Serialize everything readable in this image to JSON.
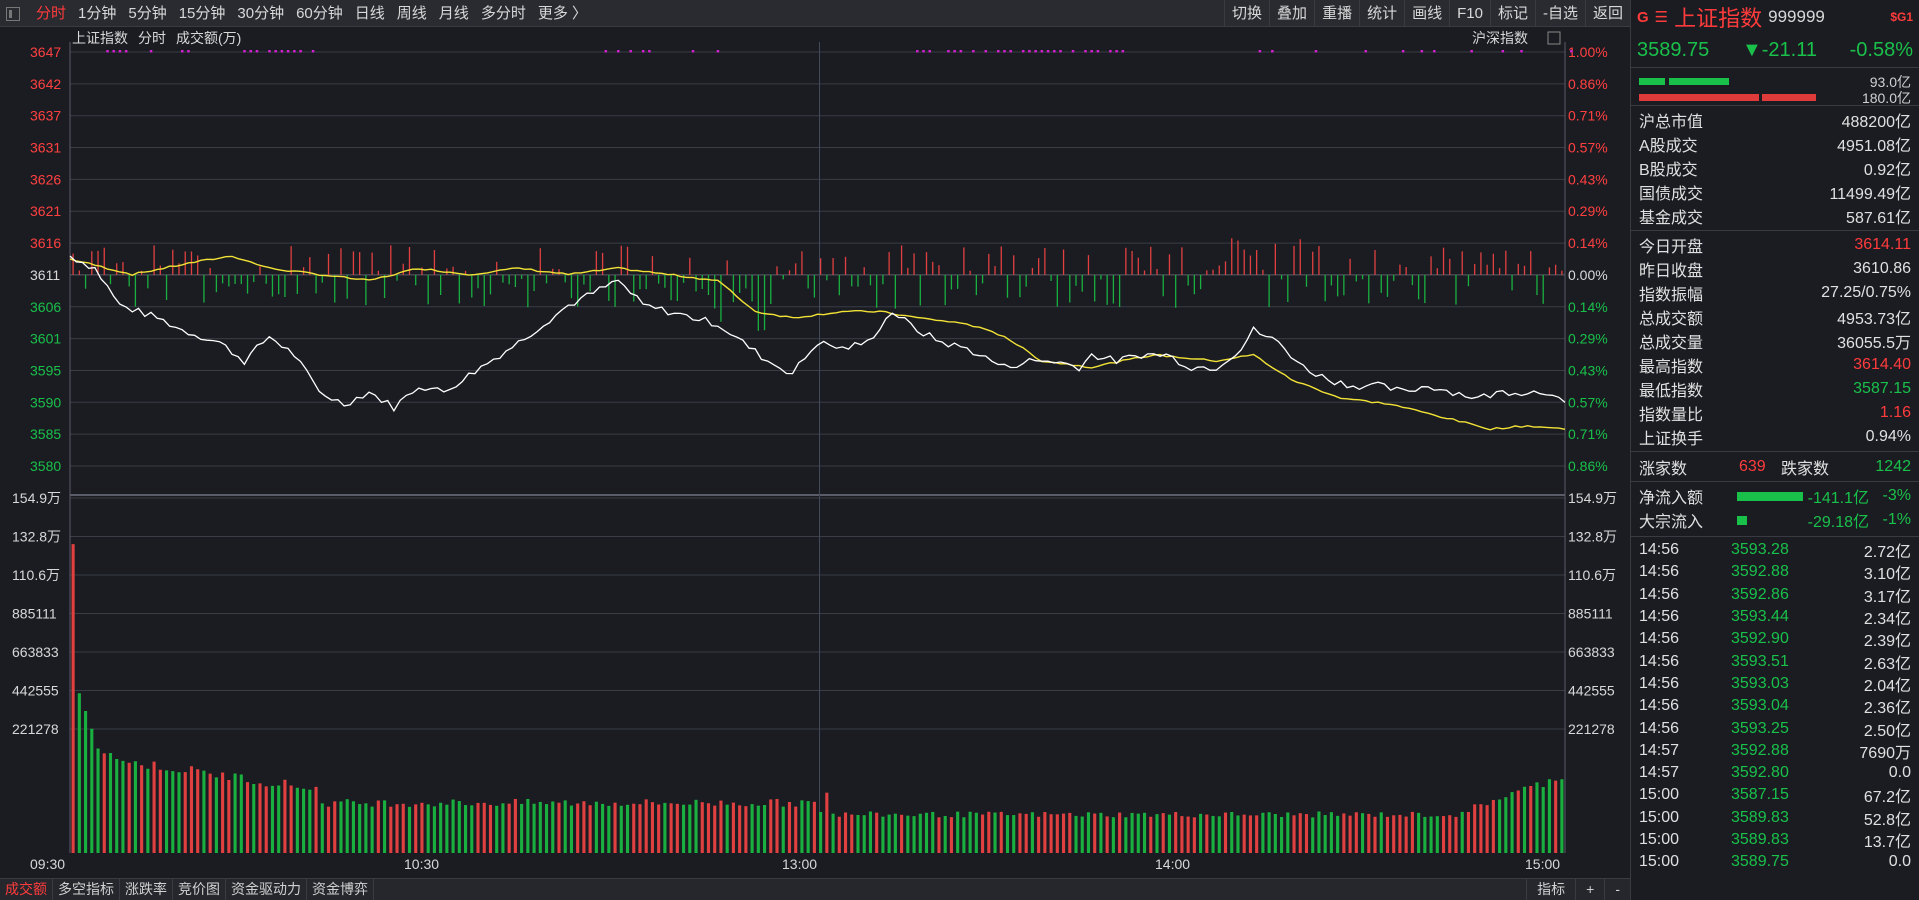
{
  "toolbar": {
    "period_tabs": [
      "分时",
      "1分钟",
      "5分钟",
      "15分钟",
      "30分钟",
      "60分钟",
      "日线",
      "周线",
      "月线",
      "多分时",
      "更多 〉"
    ],
    "active_tab": 0,
    "right_buttons": [
      "切换",
      "叠加",
      "重播",
      "统计",
      "画线",
      "F10",
      "标记",
      "-自选",
      "返回"
    ]
  },
  "chart": {
    "header_labels": [
      "上证指数",
      "分时",
      "成交额(万)"
    ],
    "overlay_label": "沪深指数",
    "price_ticks_left": [
      "3647",
      "3642",
      "3637",
      "3631",
      "3626",
      "3621",
      "3616",
      "3611",
      "3606",
      "3601",
      "3595",
      "3590",
      "3585",
      "3580"
    ],
    "pct_ticks_right": [
      "1.00%",
      "0.86%",
      "0.71%",
      "0.57%",
      "0.43%",
      "0.29%",
      "0.14%",
      "0.00%",
      "0.14%",
      "0.29%",
      "0.43%",
      "0.57%",
      "0.71%",
      "0.86%"
    ],
    "volume_ticks": [
      "154.9万",
      "132.8万",
      "110.6万",
      "885111",
      "663833",
      "442555",
      "221278"
    ],
    "time_labels": [
      "09:30",
      "10:30",
      "13:00",
      "14:00",
      "15:00"
    ],
    "colors": {
      "up": "#e04040",
      "down": "#19b040",
      "price_line": "#ffffff",
      "avg_line": "#f2e236",
      "dots": "#d020d0",
      "grid": "#3a3c46"
    }
  },
  "bottom_tabs": [
    "成交额",
    "多空指标",
    "涨跌率",
    "竞价图",
    "资金驱动力",
    "资金博弈"
  ],
  "bottom_right": [
    "指标",
    "+",
    "-"
  ],
  "panel": {
    "g_mark": "G",
    "menu_mark": "☰",
    "name": "上证指数",
    "code": "999999",
    "badge": "$G1",
    "price": "3589.75",
    "change": "▼-21.11",
    "change_pct": "-0.58%",
    "bar_value_1": "93.0亿",
    "bar_value_2": "180.0亿",
    "block1": [
      {
        "k": "沪总市值",
        "v": "488200亿"
      },
      {
        "k": "A股成交",
        "v": "4951.08亿"
      },
      {
        "k": "B股成交",
        "v": "0.92亿"
      },
      {
        "k": "国债成交",
        "v": "11499.49亿"
      },
      {
        "k": "基金成交",
        "v": "587.61亿"
      }
    ],
    "block2": [
      {
        "k": "今日开盘",
        "v": "3614.11",
        "c": "red"
      },
      {
        "k": "昨日收盘",
        "v": "3610.86",
        "c": "white"
      },
      {
        "k": "指数振幅",
        "v": "27.25/0.75%",
        "c": "white"
      },
      {
        "k": "总成交额",
        "v": "4953.73亿",
        "c": "white"
      },
      {
        "k": "总成交量",
        "v": "36055.5万",
        "c": "white"
      },
      {
        "k": "最高指数",
        "v": "3614.40",
        "c": "red"
      },
      {
        "k": "最低指数",
        "v": "3587.15",
        "c": "green"
      },
      {
        "k": "指数量比",
        "v": "1.16",
        "c": "red"
      },
      {
        "k": "上证换手",
        "v": "0.94%",
        "c": "white"
      }
    ],
    "up_label": "涨家数",
    "up_count": "639",
    "down_label": "跌家数",
    "down_count": "1242",
    "flows": [
      {
        "k": "净流入额",
        "v": "-141.1亿",
        "pct": "-3%",
        "bar": 0.55
      },
      {
        "k": "大宗流入",
        "v": "-29.18亿",
        "pct": "-1%",
        "bar": 0.08
      }
    ],
    "ticks": [
      {
        "t": "14:56",
        "p": "3593.28",
        "a": "2.72亿"
      },
      {
        "t": "14:56",
        "p": "3592.88",
        "a": "3.10亿"
      },
      {
        "t": "14:56",
        "p": "3592.86",
        "a": "3.17亿"
      },
      {
        "t": "14:56",
        "p": "3593.44",
        "a": "2.34亿"
      },
      {
        "t": "14:56",
        "p": "3592.90",
        "a": "2.39亿"
      },
      {
        "t": "14:56",
        "p": "3593.51",
        "a": "2.63亿"
      },
      {
        "t": "14:56",
        "p": "3593.03",
        "a": "2.04亿"
      },
      {
        "t": "14:56",
        "p": "3593.04",
        "a": "2.36亿"
      },
      {
        "t": "14:56",
        "p": "3593.25",
        "a": "2.50亿"
      },
      {
        "t": "14:57",
        "p": "3592.88",
        "a": "7690万"
      },
      {
        "t": "14:57",
        "p": "3592.80",
        "a": "0.0"
      },
      {
        "t": "15:00",
        "p": "3587.15",
        "a": "67.2亿"
      },
      {
        "t": "15:00",
        "p": "3589.83",
        "a": "52.8亿"
      },
      {
        "t": "15:00",
        "p": "3589.83",
        "a": "13.7亿"
      },
      {
        "t": "15:00",
        "p": "3589.75",
        "a": "0.0"
      }
    ]
  }
}
